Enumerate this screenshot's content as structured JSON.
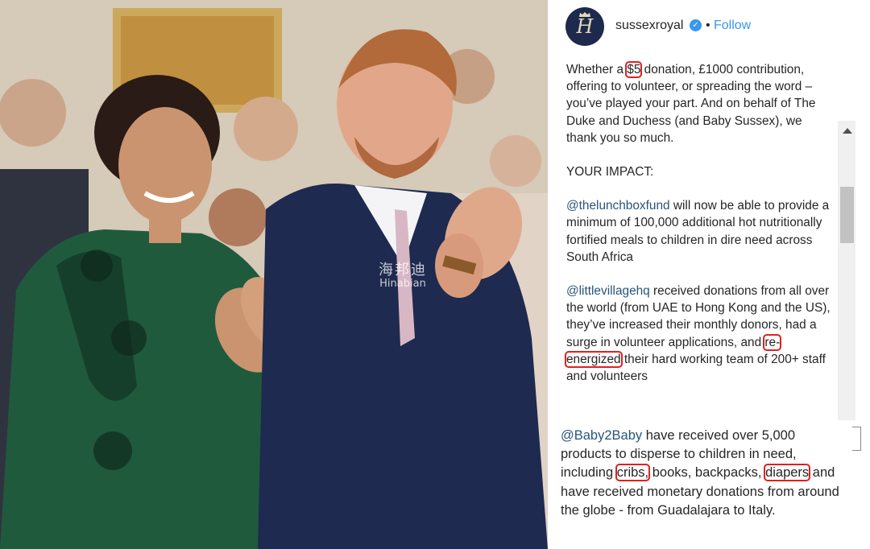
{
  "account": {
    "username": "sussexroyal",
    "avatar_monogram": "H",
    "verified_icon": "verified-badge-icon",
    "separator": "•",
    "follow_label": "Follow"
  },
  "photo": {
    "watermark_cn": "海邦迪",
    "watermark_en": "Hinabian"
  },
  "caption": {
    "p1_before": "Whether a ",
    "p1_amount": "$5",
    "p1_after": " donation, £1000 contribution, offering to volunteer, or spreading the word – you’ve played your part. And on behalf of The Duke and Duchess (and Baby Sussex), we thank you so much.",
    "impact_heading": "YOUR IMPACT:",
    "p2_mention": "@thelunchboxfund",
    "p2_text": " will now be able to provide a minimum of 100,000 additional hot nutritionally fortified meals to children in dire need across South Africa",
    "p3_mention": "@littlevillagehq",
    "p3_before": " received donations from all over the world (from UAE to Hong Kong and the US), they’ve increased their monthly donors, had a surge in volunteer applications, and ",
    "p3_highlight": "re-energized",
    "p3_after": " their hard working team of 200+ staff and volunteers"
  },
  "lower": {
    "mention": "@Baby2Baby",
    "text1": " have received over 5,000 products to disperse to children in need, including ",
    "hl1": "cribs,",
    "text2": " books, backpacks, ",
    "hl2": "diapers",
    "text3": " and have received monetary donations from around the globe - from Guadalajara to Italy."
  },
  "colors": {
    "link": "#3897f0",
    "mention": "#29557a",
    "highlight_box": "#e02020",
    "avatar_bg": "#1d2a4d"
  }
}
